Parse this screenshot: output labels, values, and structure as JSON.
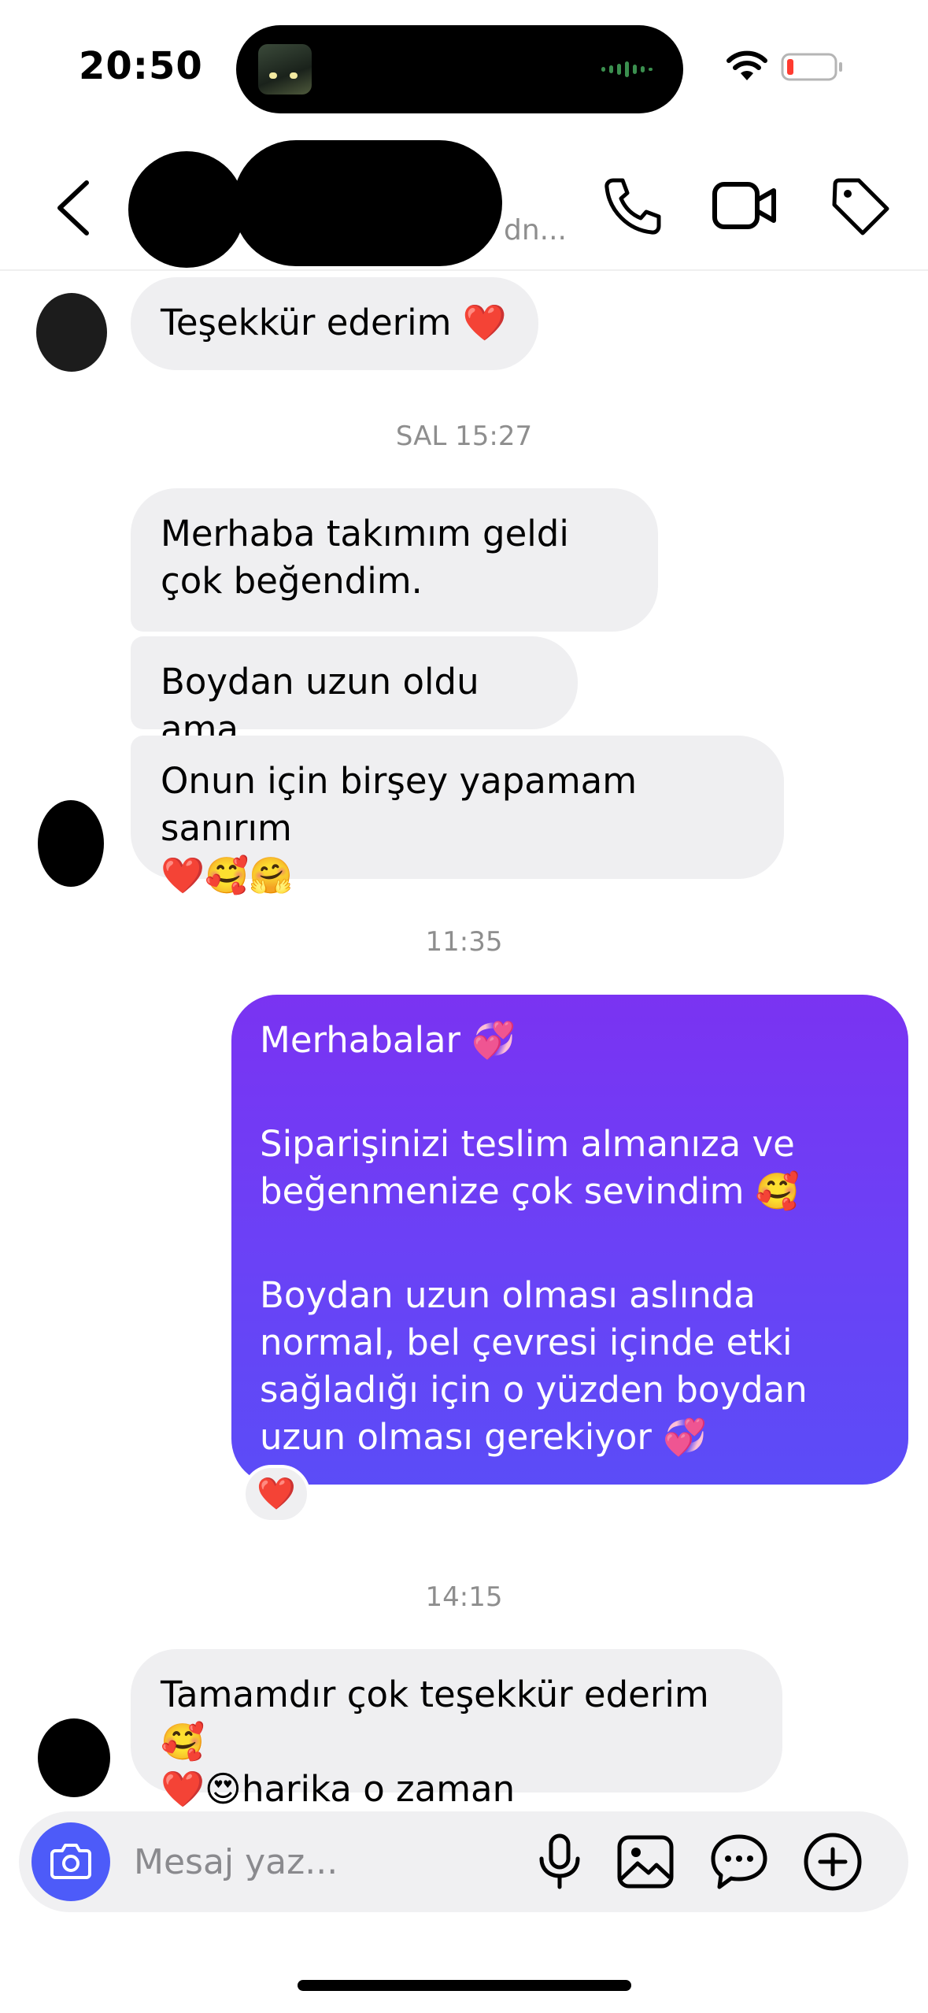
{
  "status_bar": {
    "time": "20:50"
  },
  "header": {
    "subtitle": "dn..."
  },
  "messages": {
    "m1": "Teşekkür ederim ❤️",
    "ts1": "SAL 15:27",
    "m2": "Merhaba takımım geldi çok beğendim.",
    "m3": "Boydan uzun oldu ama",
    "m4_line1": "Onun için birşey yapamam sanırım",
    "m4_line2": "❤️🥰🤗",
    "ts2": "11:35",
    "out_p1": "Merhabalar 💞",
    "out_p2": "Siparişinizi teslim almanıza ve beğenmenize çok sevindim 🥰",
    "out_p3": "Boydan uzun olması aslında normal, bel çevresi içinde etki sağladığı için o yüzden boydan uzun olması gerekiyor 💞",
    "out_reaction": "❤️",
    "ts3": "14:15",
    "m5_line1": "Tamamdır çok teşekkür ederim 🥰",
    "m5_line2": "❤️😍harika o zaman"
  },
  "composer": {
    "placeholder": "Mesaj yaz..."
  },
  "colors": {
    "outgoing_gradient_top": "#7a33f2",
    "outgoing_gradient_bottom": "#5b4cf7",
    "incoming_bubble": "#efeff1",
    "camera_button": "#4d5bf9",
    "battery_low": "#ff3b30"
  },
  "icons": [
    "back-icon",
    "call-icon",
    "video-icon",
    "tag-icon",
    "camera-icon",
    "mic-icon",
    "gallery-icon",
    "sticker-icon",
    "plus-icon",
    "wifi-icon",
    "battery-icon"
  ]
}
